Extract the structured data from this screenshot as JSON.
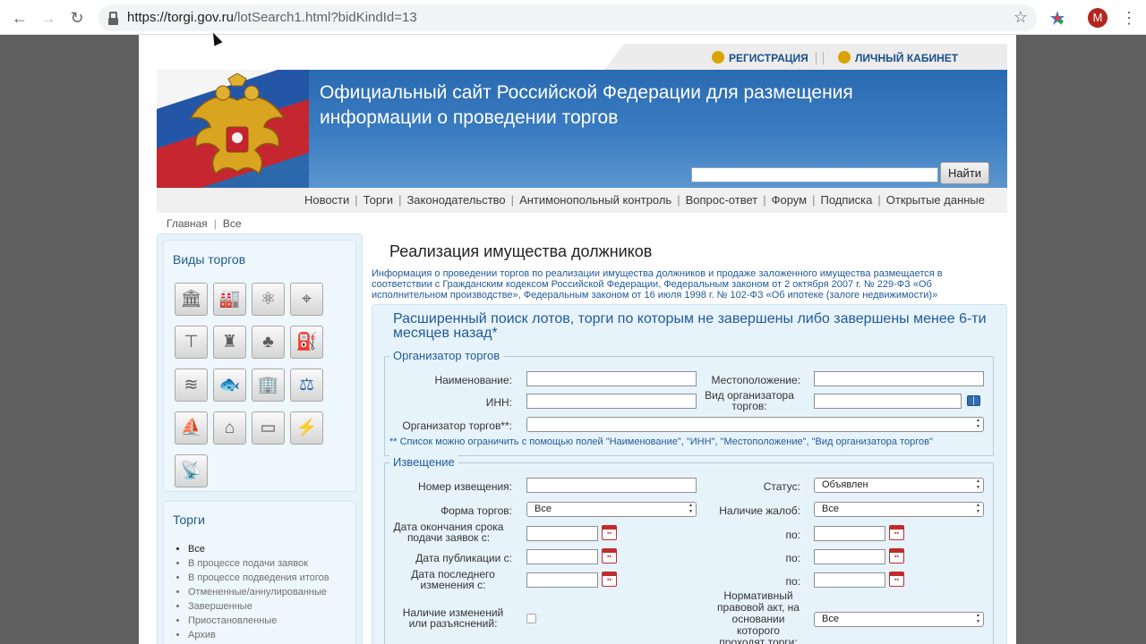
{
  "browser": {
    "url_host": "https://torgi.gov.ru",
    "url_path": "/lotSearch1.html?bidKindId=13",
    "profile_initial": "M"
  },
  "header": {
    "register_label": "РЕГИСТРАЦИЯ",
    "cabinet_label": "ЛИЧНЫЙ КАБИНЕТ",
    "site_title": "Официальный сайт Российской Федерации для размещения информации о проведении торгов",
    "search_button": "Найти"
  },
  "menu": {
    "items": [
      "Новости",
      "Торги",
      "Законодательство",
      "Антимонопольный контроль",
      "Вопрос-ответ",
      "Форум",
      "Подписка",
      "Открытые данные"
    ]
  },
  "breadcrumbs": [
    "Главная",
    "Все"
  ],
  "sidebar": {
    "kinds_title": "Виды торгов",
    "kind_icons": [
      "bank-building-icon",
      "factory-icon",
      "atom-icon",
      "survey-tripod-icon",
      "tower-crane-icon",
      "hunter-icon",
      "forest-icon",
      "oil-pump-icon",
      "water-icon",
      "fish-icon",
      "office-building-icon",
      "scales-icon",
      "boat-icon",
      "flooded-house-icon",
      "billboard-icon",
      "power-pylon-icon",
      "radio-tower-icon"
    ],
    "torgi_title": "Торги",
    "torgi_items": [
      "Все",
      "В процессе подачи заявок",
      "В процессе подведения итогов",
      "Отмененные/аннулированные",
      "Завершенные",
      "Приостановленные",
      "Архив"
    ]
  },
  "main": {
    "title": "Реализация имущества должников",
    "description": "Информация о проведении торгов по реализации имущества должников и продаже заложенного имущества размещается в соответствии с Гражданским кодексом Российской Федерации, Федеральным законом от 2 октября 2007 г. № 229-ФЗ «Об исполнительном производстве», Федеральным законом от 16 июля 1998 г. № 102-ФЗ «Об ипотеке (залоге недвижимости)»",
    "search_title": "Расширенный поиск лотов, торги по которым не завершены либо завершены менее 6-ти месяцев назад*"
  },
  "organizer": {
    "legend": "Организатор торгов",
    "name_label": "Наименование:",
    "location_label": "Местоположение:",
    "inn_label": "ИНН:",
    "org_type_label": "Вид организатора торгов:",
    "organizer_label": "Организатор торгов**:",
    "organizer_value": "",
    "note": "** Список можно ограничить с помощью полей \"Наименование\", \"ИНН\", \"Местоположение\", \"Вид организатора торгов\""
  },
  "notice": {
    "legend": "Извещение",
    "number_label": "Номер извещения:",
    "status_label": "Статус:",
    "status_value": "Объявлен",
    "form_label": "Форма торгов:",
    "form_value": "Все",
    "complaints_label": "Наличие жалоб:",
    "complaints_value": "Все",
    "deadline_label": "Дата окончания срока подачи заявок с:",
    "publication_label": "Дата публикации с:",
    "changed_label": "Дата последнего изменения с:",
    "to_label": "по:",
    "changes_label": "Наличие изменений или разъяснений:",
    "legal_act_label": "Нормативный правовой акт, на основании которого проходят торги:",
    "legal_act_value": "Все"
  }
}
